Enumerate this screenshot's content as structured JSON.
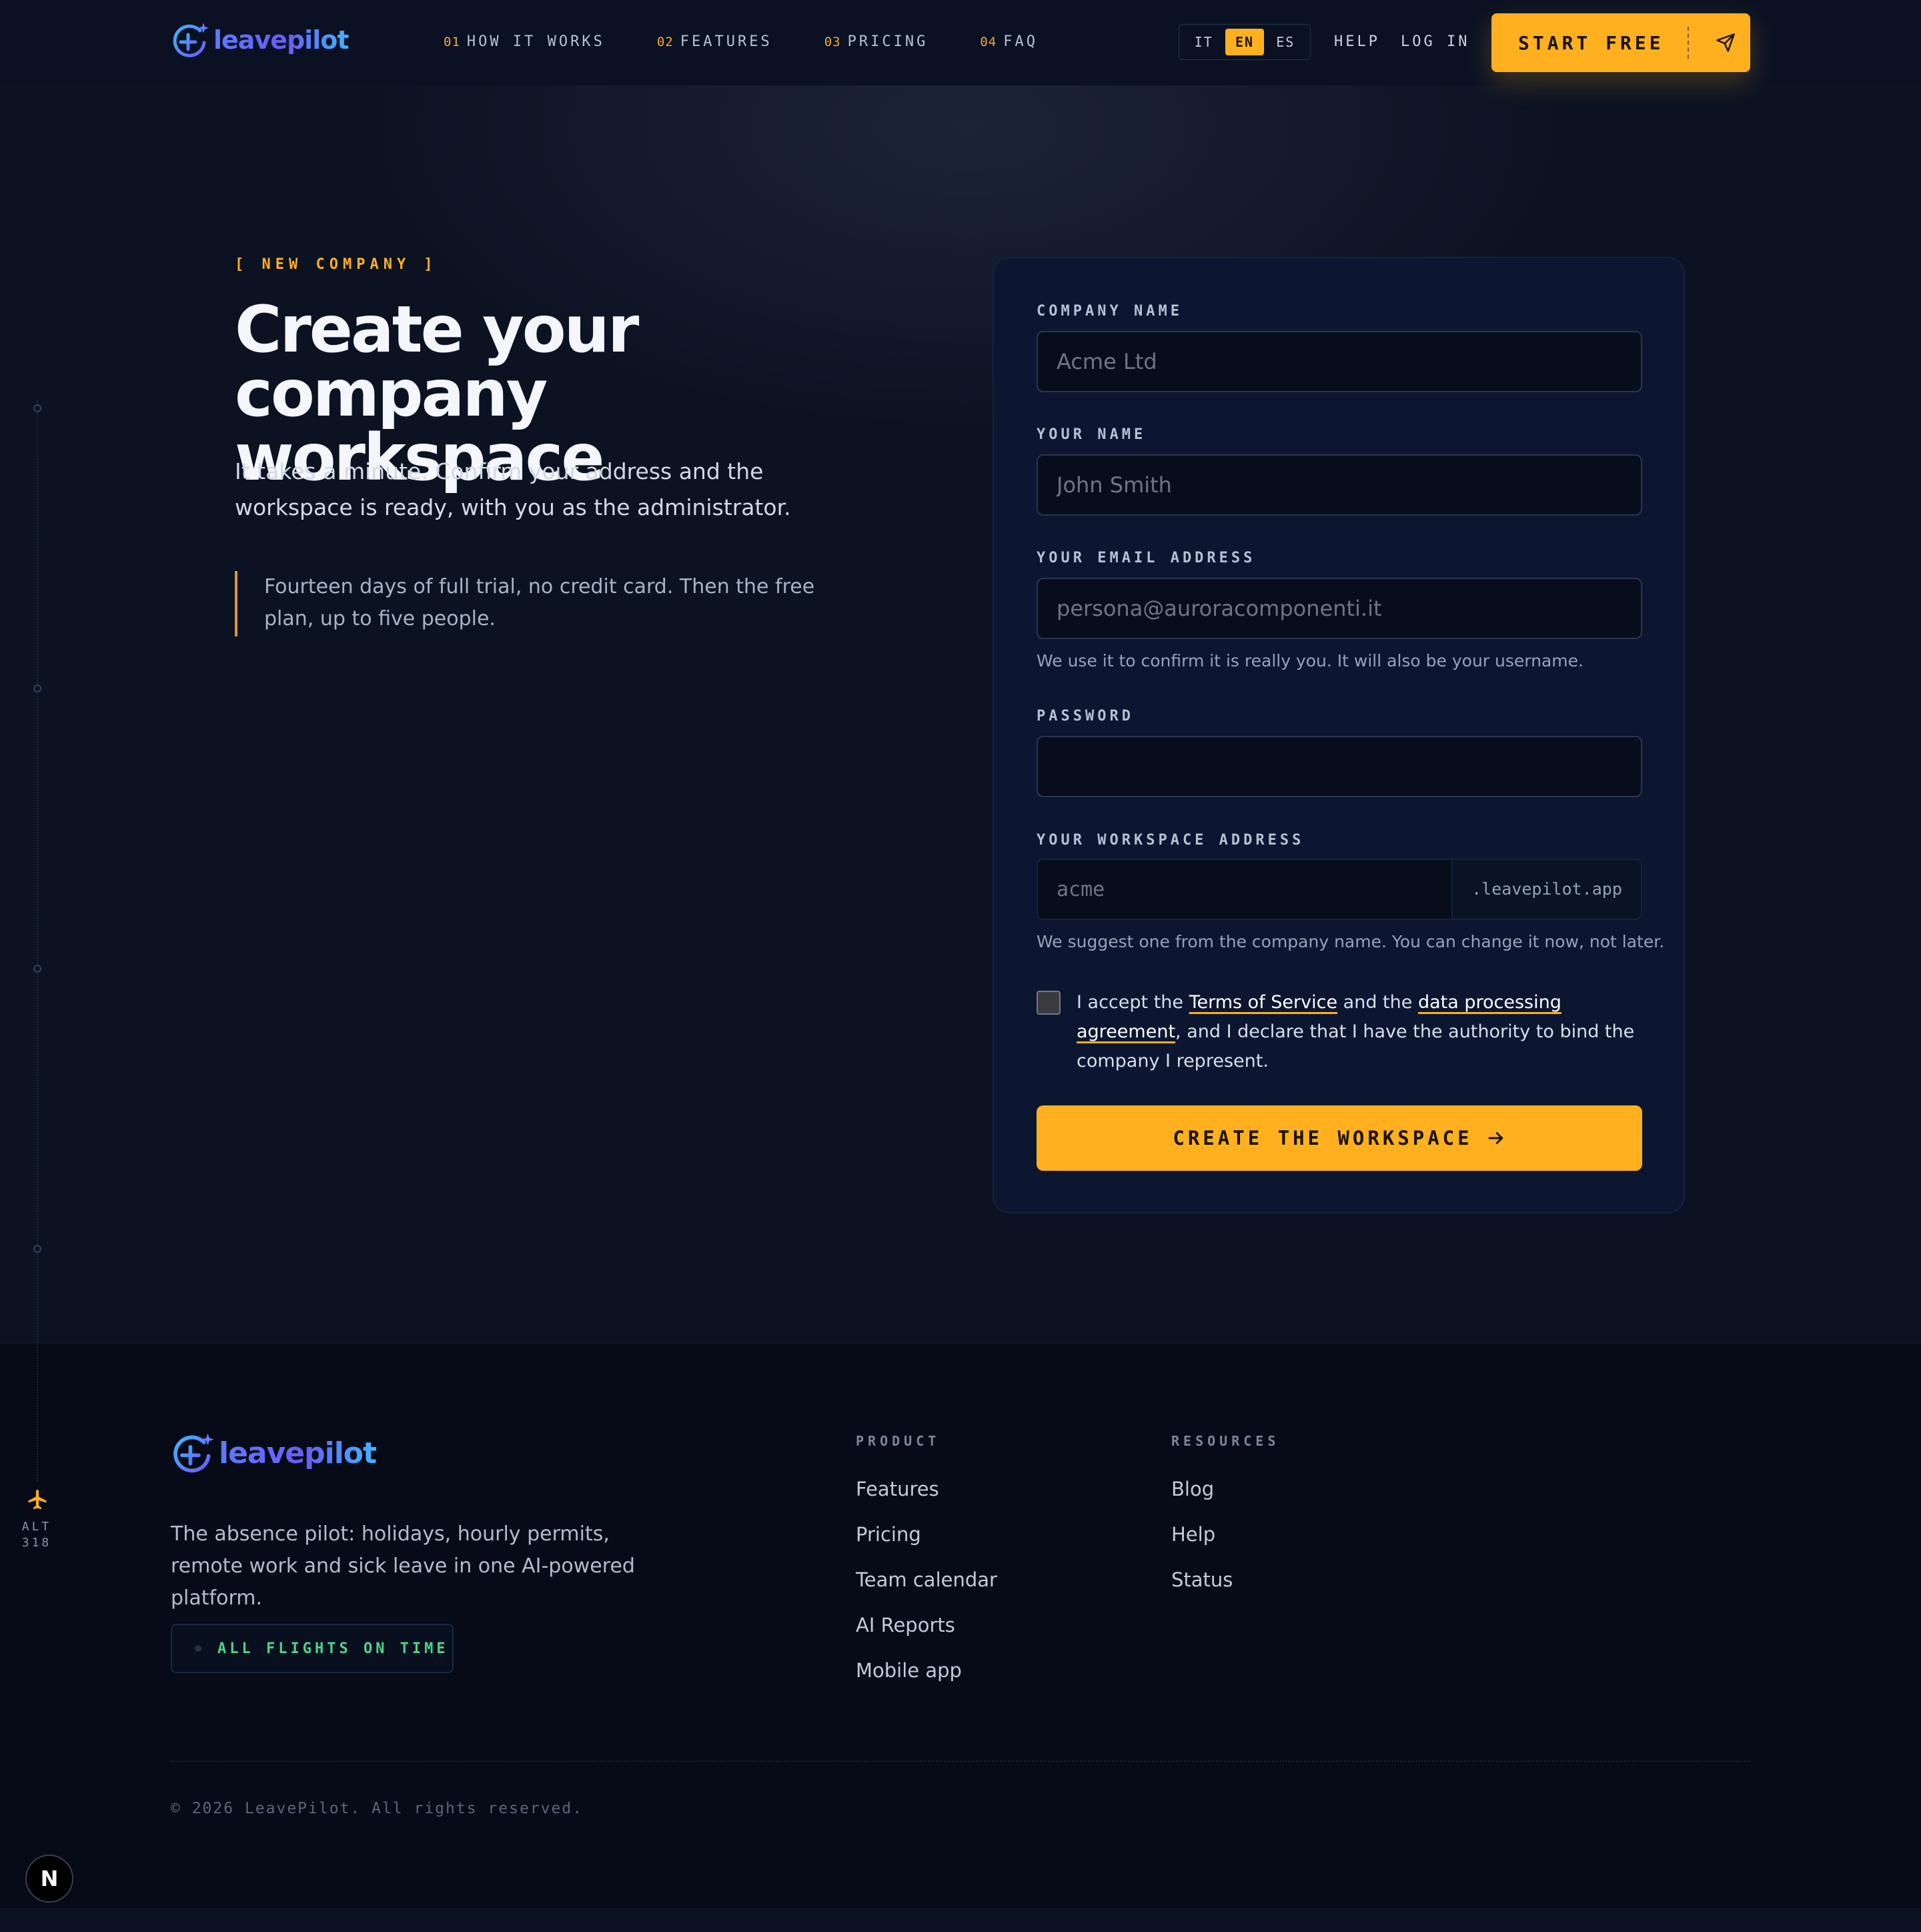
{
  "brand": {
    "name": "leavepilot"
  },
  "nav": [
    {
      "num": "01",
      "label": "HOW IT WORKS"
    },
    {
      "num": "02",
      "label": "FEATURES"
    },
    {
      "num": "03",
      "label": "PRICING"
    },
    {
      "num": "04",
      "label": "FAQ"
    }
  ],
  "languages": [
    {
      "code": "IT",
      "active": false
    },
    {
      "code": "EN",
      "active": true
    },
    {
      "code": "ES",
      "active": false
    }
  ],
  "header": {
    "help": "HELP",
    "login": "LOG IN",
    "cta": "START FREE",
    "cta_icon": "send-icon"
  },
  "rail": {
    "label": "ALT",
    "value": "318",
    "icon": "plane-icon"
  },
  "hero": {
    "eyebrow": "[ NEW COMPANY ]",
    "title": "Create your company workspace",
    "subtitle": "It takes a minute. Confirm your address and the workspace is ready, with you as the administrator.",
    "note": "Fourteen days of full trial, no credit card. Then the free plan, up to five people."
  },
  "form": {
    "company": {
      "label": "COMPANY NAME",
      "placeholder": "Acme Ltd",
      "value": ""
    },
    "name": {
      "label": "YOUR NAME",
      "placeholder": "John Smith",
      "value": ""
    },
    "email": {
      "label": "YOUR EMAIL ADDRESS",
      "placeholder": "persona@auroracomponenti.it",
      "value": "",
      "hint": "We use it to confirm it is really you. It will also be your username."
    },
    "password": {
      "label": "PASSWORD",
      "value": ""
    },
    "workspace": {
      "label": "YOUR WORKSPACE ADDRESS",
      "placeholder": "acme",
      "value": "",
      "suffix": ".leavepilot.app",
      "hint": "We suggest one from the company name. You can change it now, not later."
    },
    "terms": {
      "checked": false,
      "pre": "I accept the ",
      "tos": "Terms of Service",
      "mid": " and the ",
      "dpa": "data processing agreement",
      "post": ", and I declare that I have the authority to bind the company I represent."
    },
    "submit": "CREATE THE WORKSPACE"
  },
  "footer": {
    "description": "The absence pilot: holidays, hourly permits, remote work and sick leave in one AI-powered platform.",
    "status": "ALL FLIGHTS ON TIME",
    "product": {
      "heading": "PRODUCT",
      "links": [
        "Features",
        "Pricing",
        "Team calendar",
        "AI Reports",
        "Mobile app"
      ]
    },
    "resources": {
      "heading": "RESOURCES",
      "links": [
        "Blog",
        "Help",
        "Status"
      ]
    },
    "copyright": "© 2026 LeavePilot. All rights reserved."
  },
  "dev_badge": "N",
  "colors": {
    "accent": "#ffb01f",
    "background": "#0b1222",
    "card": "#0c1631",
    "footer": "#060b17",
    "status_green": "#4fd38a",
    "logo_gradient": [
      "#5b7cff",
      "#6a5cf5",
      "#3fb6ff"
    ]
  }
}
